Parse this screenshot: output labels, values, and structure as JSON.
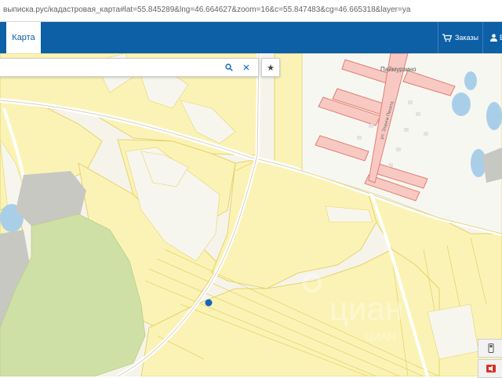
{
  "browser": {
    "url": "выписка.рус/кадастровая_карта#lat=55.845289&lng=46.664627&zoom=16&c=55.847483&cg=46.665318&layer=ya"
  },
  "navbar": {
    "active_tab": "Карта",
    "orders_label": "Заказы",
    "user_label": "В"
  },
  "search": {
    "value": "",
    "placeholder": ""
  },
  "map": {
    "village_label": "Паймурзино",
    "street_label": "ул. Этанги Пехета",
    "watermark_text": "циан",
    "watermark_sub": "ЦИАН",
    "colors": {
      "parcel_fill": "#fbf3b6",
      "parcel_border": "#e6d36a",
      "building_fill": "#f8c9c2",
      "building_border": "#e07f72",
      "forest": "#cfe0a6",
      "rock": "#c8c8c2",
      "water": "#a9cfe8",
      "nav_blue": "#0d5fa6"
    }
  }
}
